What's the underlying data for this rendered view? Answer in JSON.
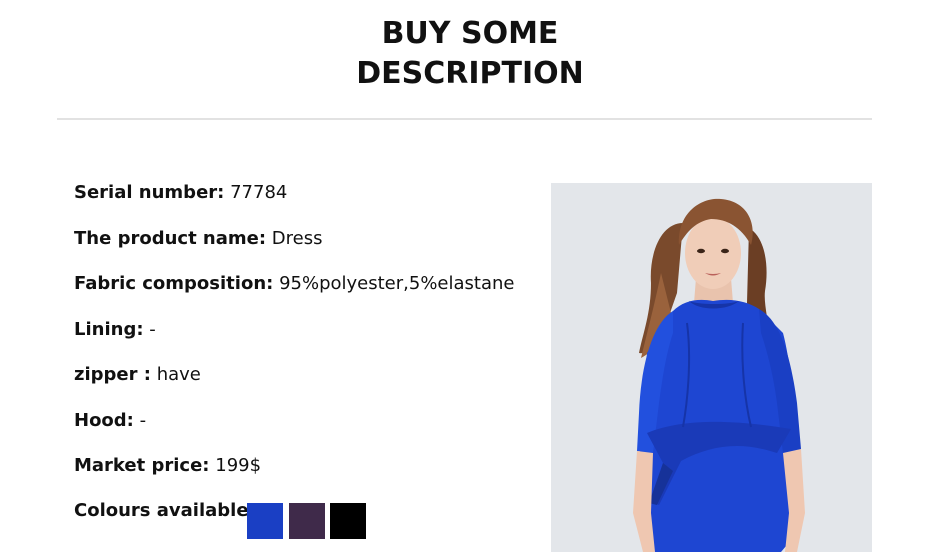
{
  "header": {
    "title_line1": "BUY SOME",
    "title_line2": "DESCRIPTION"
  },
  "specs": [
    {
      "label": "Serial number:",
      "value": " 77784"
    },
    {
      "label": "The product name:",
      "value": " Dress"
    },
    {
      "label": "Fabric composition:",
      "value": "  95%polyester,5%elastane"
    },
    {
      "label": "Lining:",
      "value": " -"
    },
    {
      "label": "zipper :",
      "value": " have"
    },
    {
      "label": "Hood:",
      "value": "  -"
    },
    {
      "label": "Market price:",
      "value": " 199$"
    }
  ],
  "colours": {
    "label": "Colours available:",
    "options": [
      {
        "name": "royal-blue",
        "hex": "#1a3fc4"
      },
      {
        "name": "plum",
        "hex": "#3f2a4a"
      },
      {
        "name": "black",
        "hex": "#000000"
      }
    ]
  },
  "colors": {
    "divider": "#e2e2e2",
    "dress": "#1e46d2",
    "background_photo": "#e3e6ea"
  }
}
